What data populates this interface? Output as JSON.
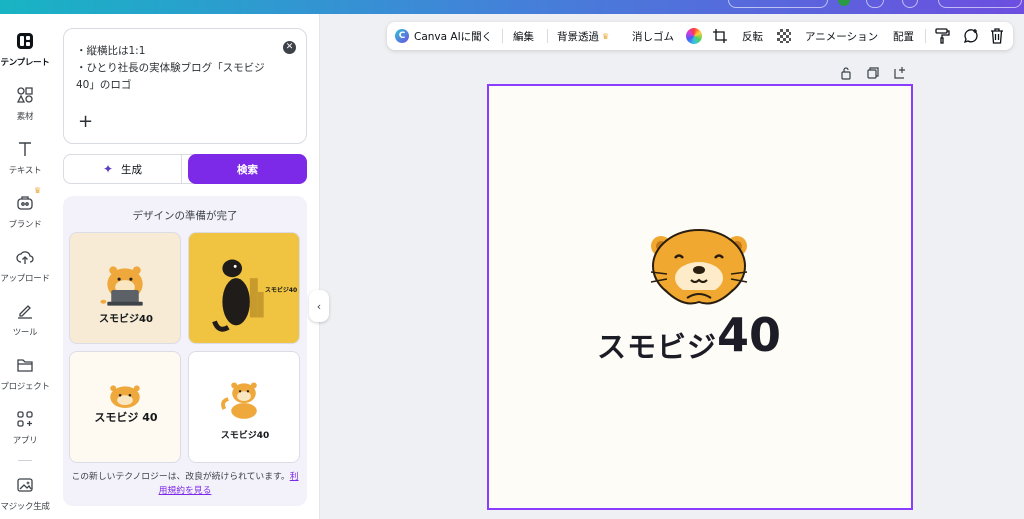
{
  "rail": {
    "items": [
      {
        "label": "テンプレート",
        "icon": "template-icon"
      },
      {
        "label": "素材",
        "icon": "elements-icon"
      },
      {
        "label": "テキスト",
        "icon": "text-icon"
      },
      {
        "label": "ブランド",
        "icon": "brand-icon"
      },
      {
        "label": "アップロード",
        "icon": "upload-icon"
      },
      {
        "label": "ツール",
        "icon": "draw-icon"
      },
      {
        "label": "プロジェクト",
        "icon": "folder-icon"
      },
      {
        "label": "アプリ",
        "icon": "apps-icon"
      },
      {
        "label": "マジック生成",
        "icon": "magic-media-icon"
      }
    ]
  },
  "panel": {
    "prompt_text": "・縦横比は1:1\n・ひとり社長の実体験ブログ「スモビジ40」のロゴ",
    "clear_symbol": "✕",
    "plus_symbol": "+",
    "generate_label": "生成",
    "search_label": "検索",
    "results_title": "デザインの準備が完了",
    "thumbnails": [
      {
        "caption": "スモビジ40"
      },
      {
        "caption": "スモビジ40"
      },
      {
        "caption": "スモビジ 40"
      },
      {
        "caption": "スモビジ40"
      }
    ],
    "disclaimer_text": "この新しいテクノロジーは、改良が続けられています。",
    "disclaimer_link": "利用規約を見る"
  },
  "toolbar": {
    "canva_ai": "Canva AIに聞く",
    "edit": "編集",
    "bg_remove": "背景透過",
    "eraser": "消しゴム",
    "flip": "反転",
    "animation": "アニメーション",
    "position": "配置"
  },
  "canvas": {
    "logo_kana": "スモビジ",
    "logo_number": "40"
  },
  "colors": {
    "accent": "#7d2ae8",
    "selection": "#8b3dff",
    "otter_orange": "#f0a830",
    "crown": "#e8a93a"
  }
}
